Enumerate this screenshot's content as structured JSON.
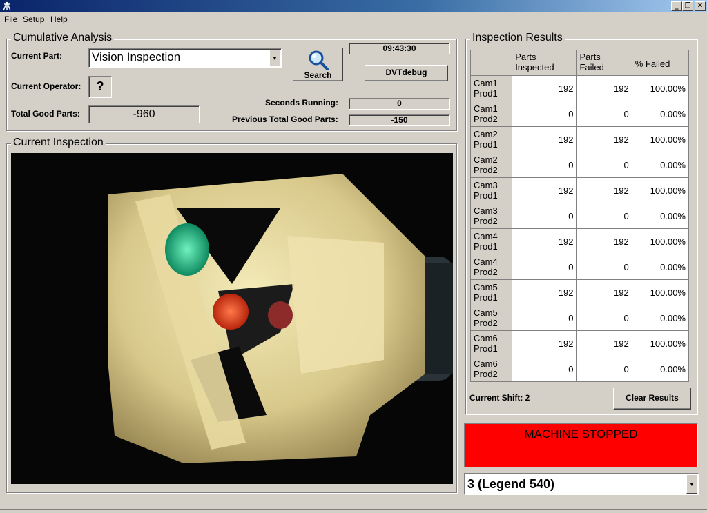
{
  "window": {
    "min_glyph": "_",
    "max_glyph": "❐",
    "close_glyph": "✕"
  },
  "menu": {
    "file": "File",
    "setup": "Setup",
    "help": "Help"
  },
  "cumulative": {
    "title": "Cumulative Analysis",
    "current_part_label": "Current Part:",
    "current_part_value": "Vision Inspection",
    "current_operator_label": "Current Operator:",
    "current_operator_value": "?",
    "total_good_label": "Total Good Parts:",
    "total_good_value": "-960",
    "search_label": "Search",
    "clock": "09:43:30",
    "debug_button": "DVTdebug",
    "seconds_running_label": "Seconds Running:",
    "seconds_running_value": "0",
    "prev_total_label": "Previous Total Good Parts:",
    "prev_total_value": "-150"
  },
  "current_inspection": {
    "title": "Current Inspection"
  },
  "results": {
    "title": "Inspection Results",
    "headers": [
      "Parts\nInspected",
      "Parts\nFailed",
      "% Failed"
    ],
    "rows": [
      {
        "cam": "Cam1",
        "prod": "Prod1",
        "inspected": "192",
        "failed": "192",
        "pct": "100.00%"
      },
      {
        "cam": "Cam1",
        "prod": "Prod2",
        "inspected": "0",
        "failed": "0",
        "pct": "0.00%"
      },
      {
        "cam": "Cam2",
        "prod": "Prod1",
        "inspected": "192",
        "failed": "192",
        "pct": "100.00%"
      },
      {
        "cam": "Cam2",
        "prod": "Prod2",
        "inspected": "0",
        "failed": "0",
        "pct": "0.00%"
      },
      {
        "cam": "Cam3",
        "prod": "Prod1",
        "inspected": "192",
        "failed": "192",
        "pct": "100.00%"
      },
      {
        "cam": "Cam3",
        "prod": "Prod2",
        "inspected": "0",
        "failed": "0",
        "pct": "0.00%"
      },
      {
        "cam": "Cam4",
        "prod": "Prod1",
        "inspected": "192",
        "failed": "192",
        "pct": "100.00%"
      },
      {
        "cam": "Cam4",
        "prod": "Prod2",
        "inspected": "0",
        "failed": "0",
        "pct": "0.00%"
      },
      {
        "cam": "Cam5",
        "prod": "Prod1",
        "inspected": "192",
        "failed": "192",
        "pct": "100.00%"
      },
      {
        "cam": "Cam5",
        "prod": "Prod2",
        "inspected": "0",
        "failed": "0",
        "pct": "0.00%"
      },
      {
        "cam": "Cam6",
        "prod": "Prod1",
        "inspected": "192",
        "failed": "192",
        "pct": "100.00%"
      },
      {
        "cam": "Cam6",
        "prod": "Prod2",
        "inspected": "0",
        "failed": "0",
        "pct": "0.00%"
      }
    ],
    "shift_label": "Current Shift: 2",
    "clear_button": "Clear Results"
  },
  "status": {
    "text": "MACHINE STOPPED",
    "color": "#ff0000"
  },
  "product_select": {
    "value": "3 (Legend 540)"
  },
  "colors": {
    "titlebar": "#0a246a",
    "face": "#d4d0c8"
  }
}
